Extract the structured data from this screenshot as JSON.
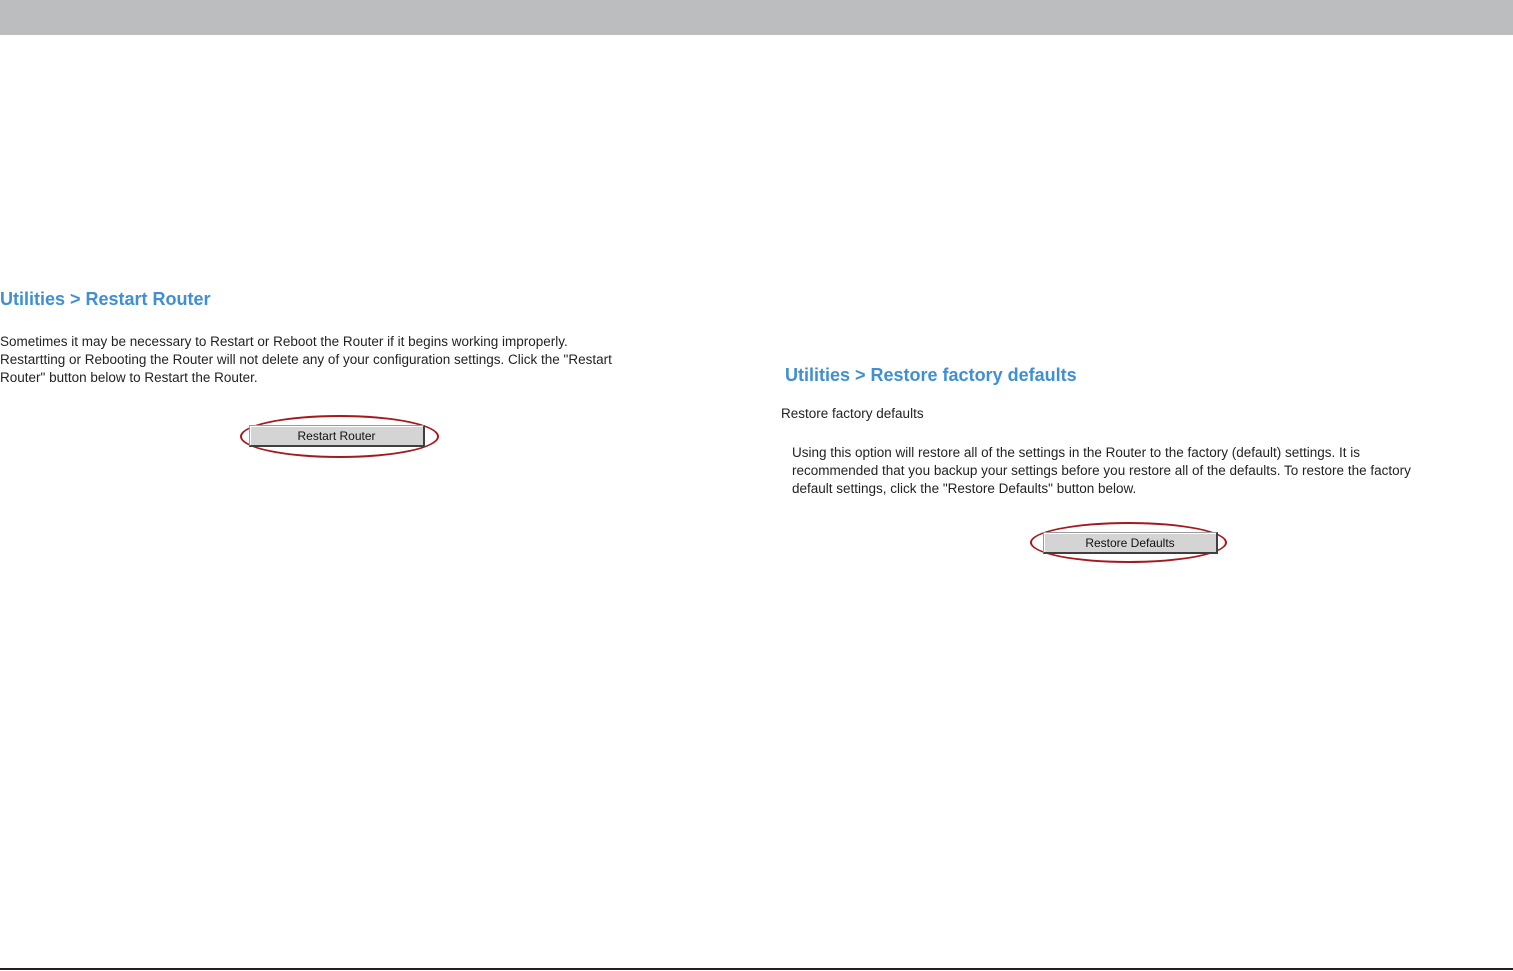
{
  "restart_panel": {
    "heading": "Utilities > Restart Router",
    "description_lines": [
      "Sometimes it may be necessary to Restart or Reboot the Router if it begins working improperly.",
      "Restartting or Rebooting the Router will not delete any of your configuration settings. Click the \"Restart",
      "Router\" button below to Restart the Router."
    ],
    "button_label": "Restart Router"
  },
  "restore_panel": {
    "heading": "Utilities > Restore factory defaults",
    "subtitle": "Restore factory defaults",
    "description_lines": [
      "Using this option will restore all of the settings in the Router to the factory (default) settings. It is",
      "recommended that you backup your settings before you restore all of the defaults. To restore the factory",
      "default settings, click the \"Restore Defaults\" button below."
    ],
    "button_label": "Restore Defaults"
  },
  "colors": {
    "heading": "#3f8fd2",
    "highlight_ring": "#a3191e",
    "top_bar": "#bcbdbf"
  }
}
